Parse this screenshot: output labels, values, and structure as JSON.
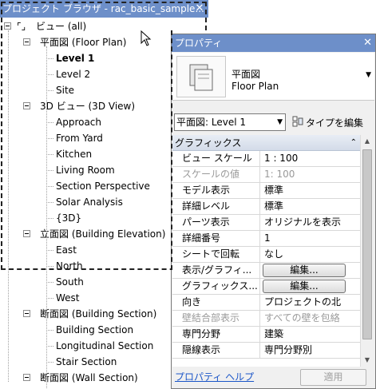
{
  "browser": {
    "title": "プロジェクト ブラウザ - rac_basic_sample...",
    "close": "✕",
    "tree": [
      {
        "label": "ビュー (all)",
        "icon": "views-icon",
        "level": 0,
        "expander": true
      },
      {
        "label": "平面図 (Floor Plan)",
        "level": 1,
        "expander": true
      },
      {
        "label": "Level 1",
        "level": 2,
        "selected": true
      },
      {
        "label": "Level 2",
        "level": 2
      },
      {
        "label": "Site",
        "level": 2
      },
      {
        "label": "3D ビュー (3D View)",
        "level": 1,
        "expander": true
      },
      {
        "label": "Approach",
        "level": 2
      },
      {
        "label": "From Yard",
        "level": 2
      },
      {
        "label": "Kitchen",
        "level": 2
      },
      {
        "label": "Living Room",
        "level": 2
      },
      {
        "label": "Section Perspective",
        "level": 2
      },
      {
        "label": "Solar Analysis",
        "level": 2
      },
      {
        "label": "{3D}",
        "level": 2
      },
      {
        "label": "立面図 (Building Elevation)",
        "level": 1,
        "expander": true
      },
      {
        "label": "East",
        "level": 2
      },
      {
        "label": "North",
        "level": 2
      },
      {
        "label": "South",
        "level": 2
      },
      {
        "label": "West",
        "level": 2
      },
      {
        "label": "断面図 (Building Section)",
        "level": 1,
        "expander": true
      },
      {
        "label": "Building Section",
        "level": 2
      },
      {
        "label": "Longitudinal Section",
        "level": 2
      },
      {
        "label": "Stair Section",
        "level": 2
      },
      {
        "label": "断面図 (Wall Section)",
        "level": 1,
        "expander": true
      }
    ]
  },
  "properties": {
    "title": "プロパティ",
    "close": "✕",
    "type_family": "平面図",
    "type_name": "Floor Plan",
    "instance_selector": "平面図: Level 1",
    "edit_type": "タイプを編集",
    "group": "グラフィックス",
    "group_collapse": "⌃⌃",
    "rows": [
      {
        "name": "ビュー スケール",
        "value": "1 : 100"
      },
      {
        "name": "スケールの値",
        "value": "1: 100",
        "disabled": true
      },
      {
        "name": "モデル表示",
        "value": "標準"
      },
      {
        "name": "詳細レベル",
        "value": "標準"
      },
      {
        "name": "パーツ表示",
        "value": "オリジナルを表示"
      },
      {
        "name": "詳細番号",
        "value": "1"
      },
      {
        "name": "シートで回転",
        "value": "なし"
      },
      {
        "name": "表示/グラフィ...",
        "button": "編集..."
      },
      {
        "name": "グラフィックス...",
        "button": "編集..."
      },
      {
        "name": "向き",
        "value": "プロジェクトの北"
      },
      {
        "name": "壁結合部表示",
        "value": "すべての壁を包絡",
        "disabled": true
      },
      {
        "name": "専門分野",
        "value": "建築"
      },
      {
        "name": "隠線表示",
        "value": "専門分野別"
      }
    ],
    "help": "プロパティ ヘルプ",
    "apply": "適用"
  },
  "colors": {
    "title_bar": "#6d8fc9",
    "link": "#1a55c8"
  }
}
